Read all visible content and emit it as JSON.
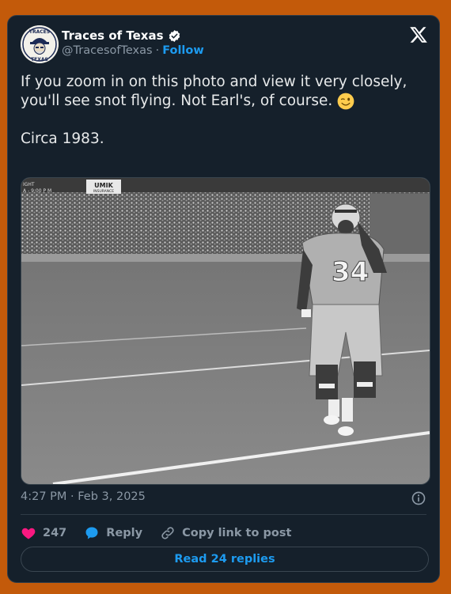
{
  "author": {
    "display_name": "Traces of Texas",
    "handle": "@TracesofTexas",
    "separator": "·",
    "follow_label": "Follow",
    "avatar_text_top": "TRACES",
    "avatar_text_bottom": "TEXAS"
  },
  "tweet": {
    "line1": "If you zoom in on this photo and view it very closely, you'll see snot flying. Not Earl's, of course.",
    "line2": "Circa 1983.",
    "emoji": "winking-face"
  },
  "photo": {
    "jersey_number": "34",
    "sign_left_1": "IGHT",
    "sign_left_2": "A - 9:00 P M",
    "sign_center": "UMIK",
    "sign_center_sub": "INSURANCE"
  },
  "meta": {
    "timestamp": "4:27 PM · Feb 3, 2025"
  },
  "actions": {
    "like_count": "247",
    "reply_label": "Reply",
    "copy_label": "Copy link to post"
  },
  "read_replies_label": "Read 24 replies",
  "colors": {
    "accent": "#1d9bf0",
    "background": "#15202b",
    "like": "#f91880",
    "page": "#c35a0a"
  }
}
